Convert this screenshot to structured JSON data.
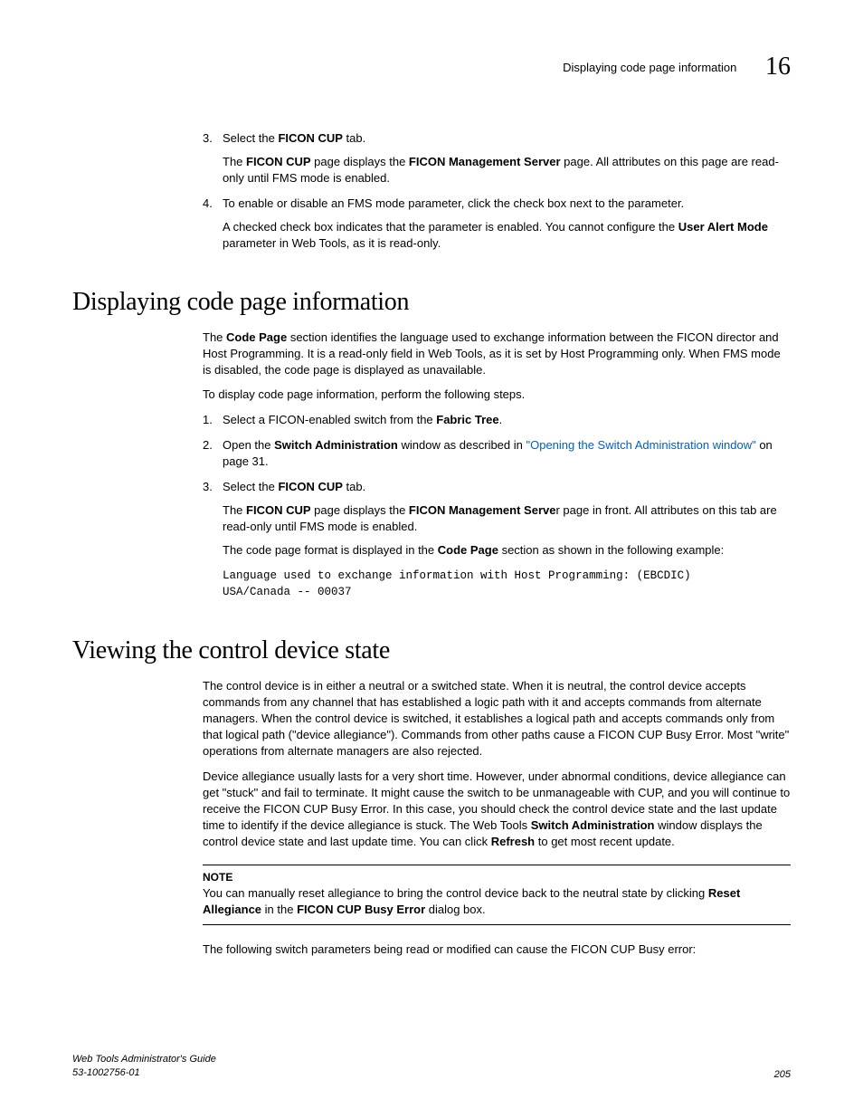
{
  "header": {
    "running_title": "Displaying code page information",
    "chapter_number": "16"
  },
  "step3": {
    "num": "3.",
    "t1": "Select the ",
    "bold1": "FICON CUP",
    "t2": " tab.",
    "sub_t1": "The ",
    "sub_b1": "FICON CUP",
    "sub_t2": " page displays the ",
    "sub_b2": "FICON Management Server",
    "sub_t3": " page. All attributes on this page are read-only until FMS mode is enabled."
  },
  "step4": {
    "num": "4.",
    "t1": "To enable or disable an FMS mode parameter, click the check box next to the parameter.",
    "sub_t1": "A checked check box indicates that the parameter is enabled. You cannot configure the ",
    "sub_b1": "User Alert Mode",
    "sub_t2": " parameter in Web Tools, as it is read-only."
  },
  "h1": "Displaying code page information",
  "s1": {
    "p1a": "The ",
    "p1b": "Code Page",
    "p1c": " section identifies the language used to exchange information between the FICON director and Host Programming. It is a read-only field in Web Tools, as it is set by Host Programming only. When FMS mode is disabled, the code page is displayed as unavailable.",
    "p2": "To display code page information, perform the following steps.",
    "li1": {
      "num": "1.",
      "t1": "Select a FICON-enabled switch from the ",
      "b1": "Fabric Tree",
      "t2": "."
    },
    "li2": {
      "num": "2.",
      "t1": "Open the ",
      "b1": "Switch Administration",
      "t2": " window as described in ",
      "link": "\"Opening the Switch Administration window\"",
      "t3": " on page 31."
    },
    "li3": {
      "num": "3.",
      "t1": "Select the ",
      "b1": "FICON CUP",
      "t2": " tab.",
      "sub_t1": "The ",
      "sub_b1": "FICON CUP",
      "sub_t2": " page displays the ",
      "sub_b2": "FICON Management Serve",
      "sub_t3": "r page in front. All attributes on this tab are read-only until FMS mode is enabled.",
      "sub2_t1": "The code page format is displayed in the ",
      "sub2_b1": "Code Page",
      "sub2_t2": " section as shown in the following example:"
    },
    "code": "Language used to exchange information with Host Programming: (EBCDIC)\nUSA/Canada -- 00037"
  },
  "h2": "Viewing the control device state",
  "s2": {
    "p1": "The control device is in either a neutral or a switched state. When it is neutral, the control device accepts commands from any channel that has established a logic path with it and accepts commands from alternate managers. When the control device is switched, it establishes a logical path and accepts commands only from that logical path (\"device allegiance\"). Commands from other paths cause a FICON CUP Busy Error. Most \"write\" operations from alternate managers are also rejected.",
    "p2a": "Device allegiance usually lasts for a very short time. However, under abnormal conditions, device allegiance can get \"stuck\" and fail to terminate. It might cause the switch to be unmanageable with CUP, and you will continue to receive the FICON CUP Busy Error. In this case, you should check the control device state and the last update time to identify if the device allegiance is stuck. The Web Tools ",
    "p2b": "Switch Administration",
    "p2c": " window displays the control device state and last update time. You can click ",
    "p2d": "Refresh",
    "p2e": " to get most recent update.",
    "note_title": "NOTE",
    "note_t1": "You can manually reset allegiance to bring the control device back to the neutral state by clicking ",
    "note_b1": "Reset Allegiance",
    "note_t2": " in the ",
    "note_b2": "FICON CUP Busy Error",
    "note_t3": " dialog box.",
    "p3": "The following switch parameters being read or modified can cause the FICON CUP Busy error:"
  },
  "footer": {
    "title": "Web Tools Administrator's Guide",
    "docnum": "53-1002756-01",
    "page": "205"
  }
}
